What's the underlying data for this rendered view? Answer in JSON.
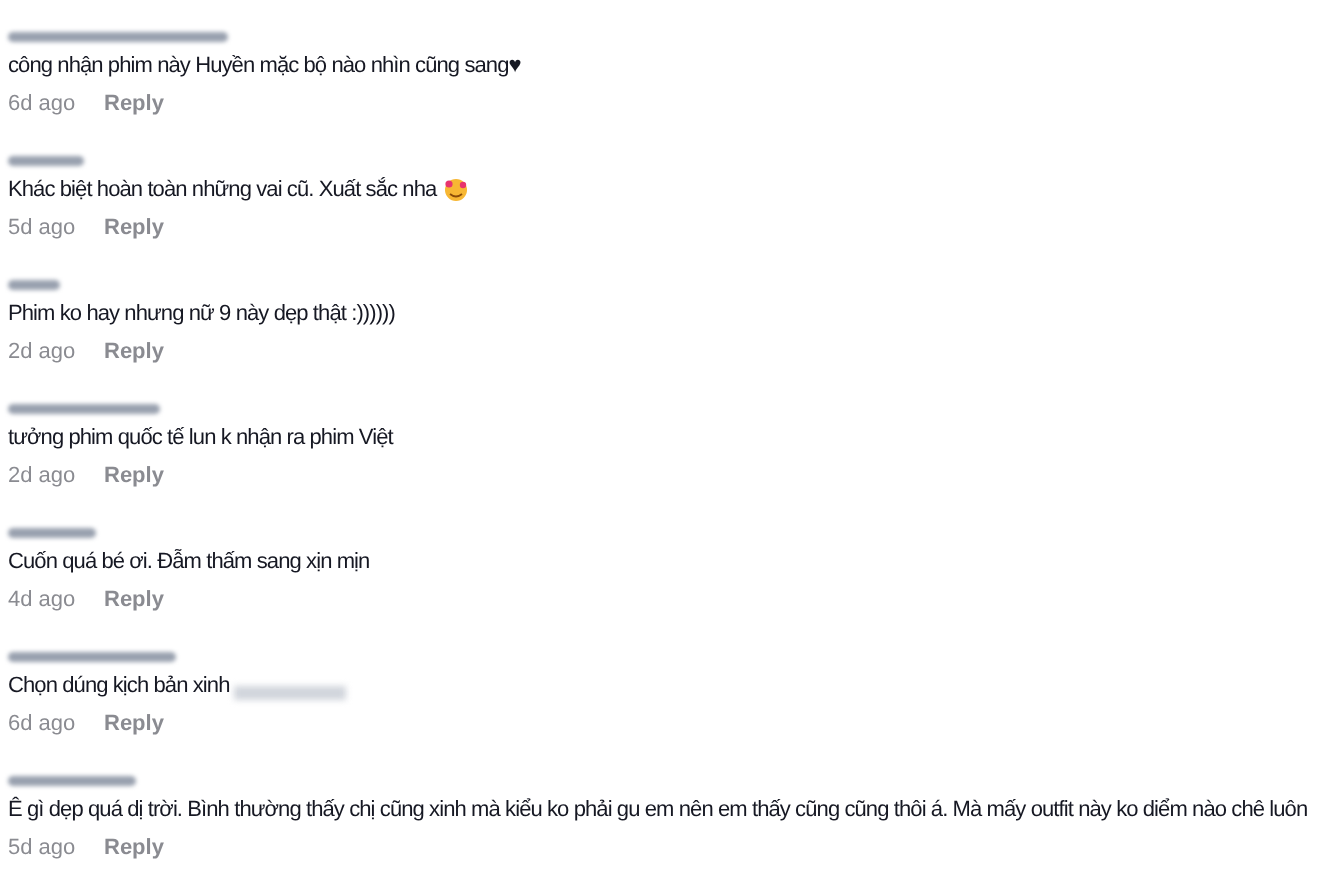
{
  "comments": [
    {
      "text": "công nhận phim này Huyền mặc bộ nào nhìn cũng sang♥",
      "time": "6d ago",
      "reply": "Reply"
    },
    {
      "text": "Khác biệt hoàn toàn những vai cũ. Xuất sắc nha",
      "emoji": true,
      "time": "5d ago",
      "reply": "Reply"
    },
    {
      "text": "Phim ko hay nhưng nữ 9 này dẹp thật :))))))",
      "time": "2d ago",
      "reply": "Reply"
    },
    {
      "text": "tưởng phim quốc tế lun k nhận ra phim Việt",
      "time": "2d ago",
      "reply": "Reply"
    },
    {
      "text": "Cuốn quá bé ơi. Đẫm thấm sang xịn mịn",
      "time": "4d ago",
      "reply": "Reply"
    },
    {
      "text": "Chọn dúng kịch bản xinh",
      "redacted_tail": true,
      "time": "6d ago",
      "reply": "Reply"
    },
    {
      "text": "Ê gì dẹp quá dị trời. Bình thường thấy chị cũng xinh mà kiểu ko phải gu em nên em thấy cũng cũng thôi á. Mà mấy outfit này ko diểm nào chê luôn",
      "time": "5d ago",
      "reply": "Reply"
    }
  ]
}
